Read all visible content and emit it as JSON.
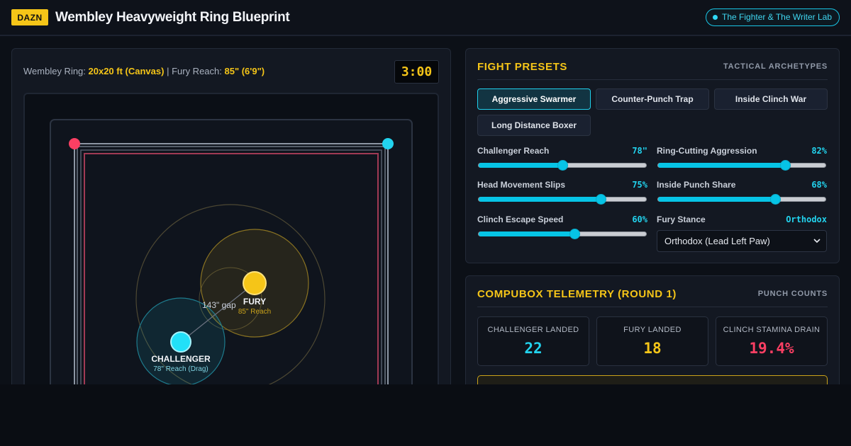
{
  "header": {
    "badge": "DAZN",
    "title": "Wembley Heavyweight Ring Blueprint",
    "lab_link": "The Fighter & The Writer Lab"
  },
  "ring": {
    "info_prefix": "Wembley Ring: ",
    "size": "20x20 ft (Canvas)",
    "separator": " | Fury Reach: ",
    "fury_reach": "85\" (6'9\")",
    "clock": "3:00",
    "gap_label": "143\" gap",
    "fury_name": "FURY",
    "fury_sub": "85\" Reach",
    "challenger_name": "CHALLENGER",
    "challenger_sub": "78\" Reach (Drag)"
  },
  "presets": {
    "title": "FIGHT PRESETS",
    "subtitle": "TACTICAL ARCHETYPES",
    "buttons": [
      {
        "label": "Aggressive Swarmer",
        "active": true
      },
      {
        "label": "Counter-Punch Trap",
        "active": false
      },
      {
        "label": "Inside Clinch War",
        "active": false
      },
      {
        "label": "Long Distance Boxer",
        "active": false
      }
    ],
    "sliders": [
      {
        "label": "Challenger Reach",
        "display": "78\"",
        "fraction": 0.5
      },
      {
        "label": "Ring-Cutting Aggression",
        "display": "82%",
        "fraction": 0.76
      },
      {
        "label": "Head Movement Slips",
        "display": "75%",
        "fraction": 0.73
      },
      {
        "label": "Inside Punch Share",
        "display": "68%",
        "fraction": 0.7
      },
      {
        "label": "Clinch Escape Speed",
        "display": "60%",
        "fraction": 0.57
      }
    ],
    "stance": {
      "label": "Fury Stance",
      "display": "Orthodox",
      "selected": "Orthodox (Lead Left Paw)"
    }
  },
  "telemetry": {
    "title": "COMPUBOX TELEMETRY (ROUND 1)",
    "subtitle": "PUNCH COUNTS",
    "stats": [
      {
        "label": "CHALLENGER LANDED",
        "value": "22",
        "color": "#22d3ee"
      },
      {
        "label": "FURY LANDED",
        "value": "18",
        "color": "#f5c518"
      },
      {
        "label": "CLINCH STAMINA DRAIN",
        "value": "19.4%",
        "color": "#fb3f63"
      }
    ]
  },
  "colors": {
    "accent": "#f5c518",
    "cyan": "#22d3ee",
    "red": "#fb3f63"
  }
}
